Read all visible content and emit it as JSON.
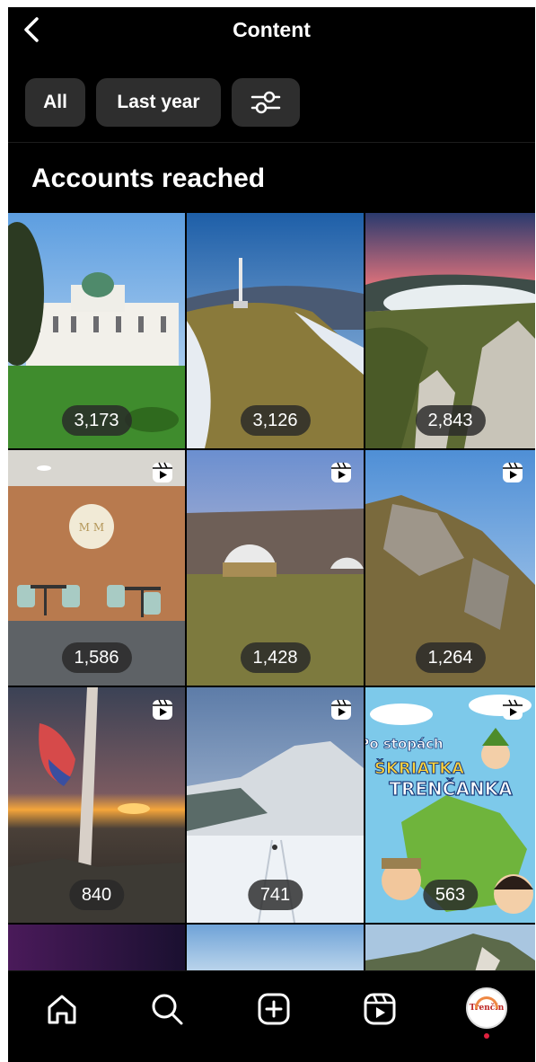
{
  "header": {
    "title": "Content",
    "back_icon": "chevron-left-icon"
  },
  "filters": {
    "all_label": "All",
    "period_label": "Last year",
    "settings_icon": "sliders-icon"
  },
  "section_title": "Accounts reached",
  "posts": [
    {
      "reach": "3,173",
      "reel": false,
      "scene": "palace"
    },
    {
      "reach": "3,126",
      "reel": false,
      "scene": "hill-tower"
    },
    {
      "reach": "2,843",
      "reel": false,
      "scene": "fog-valley"
    },
    {
      "reach": "1,586",
      "reel": true,
      "scene": "cafe"
    },
    {
      "reach": "1,428",
      "reel": true,
      "scene": "glamping"
    },
    {
      "reach": "1,264",
      "reel": true,
      "scene": "cliffs"
    },
    {
      "reach": "840",
      "reel": true,
      "scene": "sunset-flag"
    },
    {
      "reach": "741",
      "reel": true,
      "scene": "snow-hill"
    },
    {
      "reach": "563",
      "reel": true,
      "scene": "cartoon"
    }
  ],
  "poster_text": {
    "line1": "Po stopách",
    "line2": "ŠKRIATKA",
    "line3": "TRENČANKA"
  },
  "nav": {
    "items": [
      "home-icon",
      "search-icon",
      "create-icon",
      "reels-icon",
      "profile-avatar"
    ],
    "avatar_text": "Trenčín"
  },
  "colors": {
    "background": "#000000",
    "chip": "#2e2e2e",
    "notification_dot": "#e0213e"
  }
}
